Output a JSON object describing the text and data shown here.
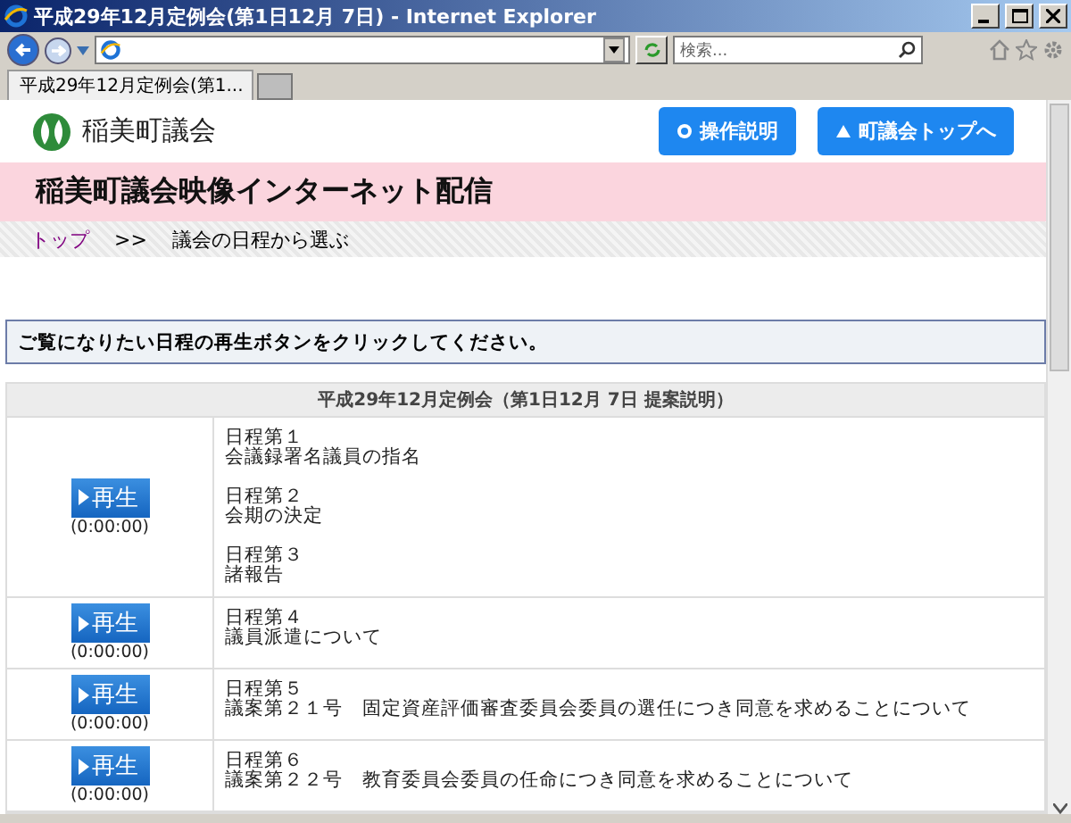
{
  "window": {
    "title": "平成29年12月定例会(第1日12月 7日) - Internet Explorer"
  },
  "search": {
    "placeholder": "検索..."
  },
  "tabs": [
    {
      "label": "平成29年12月定例会(第1...",
      "selected": true
    }
  ],
  "site": {
    "name": "稲美町議会",
    "buttons": [
      {
        "label": "操作説明",
        "kind": "help"
      },
      {
        "label": "町議会トップへ",
        "kind": "home"
      }
    ]
  },
  "banner": {
    "title": "稲美町議会映像インターネット配信"
  },
  "breadcrumb": {
    "link": "トップ",
    "separator": ">>",
    "current": "議会の日程から選ぶ"
  },
  "notice": "ご覧になりたい日程の再生ボタンをクリックしてください。",
  "table": {
    "heading": "平成29年12月定例会（第1日12月 7日 提案説明）",
    "rows": [
      {
        "play": "再生",
        "time": "(0:00:00)",
        "items": [
          {
            "number": "日程第１",
            "title": "会議録署名議員の指名"
          },
          {
            "number": "日程第２",
            "title": "会期の決定"
          },
          {
            "number": "日程第３",
            "title": "諸報告"
          }
        ]
      },
      {
        "play": "再生",
        "time": "(0:00:00)",
        "items": [
          {
            "number": "日程第４",
            "title": "議員派遣について"
          }
        ]
      },
      {
        "play": "再生",
        "time": "(0:00:00)",
        "items": [
          {
            "number": "日程第５",
            "title": "議案第２１号　固定資産評価審査委員会委員の選任につき同意を求めることについて"
          }
        ]
      },
      {
        "play": "再生",
        "time": "(0:00:00)",
        "items": [
          {
            "number": "日程第６",
            "title": "議案第２２号　教育委員会委員の任命につき同意を求めることについて"
          }
        ]
      }
    ]
  }
}
